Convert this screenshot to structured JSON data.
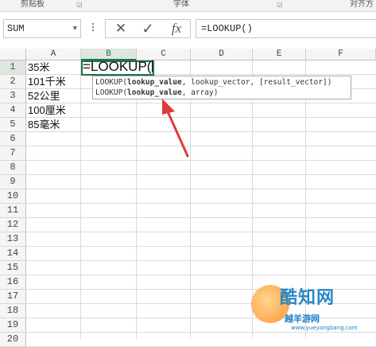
{
  "ribbon": {
    "group1": "剪贴板",
    "group2": "字体",
    "group3": "对齐方"
  },
  "name_box": {
    "value": "SUM"
  },
  "formula_bar": {
    "cancel_glyph": "✕",
    "enter_glyph": "✓",
    "fx_label": "fx",
    "value": "=LOOKUP()"
  },
  "columns": [
    "A",
    "B",
    "C",
    "D",
    "E",
    "F"
  ],
  "rows": [
    "1",
    "2",
    "3",
    "4",
    "5",
    "6",
    "7",
    "8",
    "9",
    "10",
    "11",
    "12",
    "13",
    "14",
    "15",
    "16",
    "17",
    "18",
    "19",
    "20"
  ],
  "cells": {
    "A1": "35米",
    "A2": "101千米",
    "A3": "52公里",
    "A4": "100厘米",
    "A5": "85毫米"
  },
  "active_cell": {
    "ref": "B1",
    "text": "=LOOKUP("
  },
  "tooltip": {
    "line1_fn": "LOOKUP(",
    "line1_bold": "lookup_value",
    "line1_rest": ", lookup_vector, [result_vector])",
    "line2_fn": "LOOKUP(",
    "line2_bold": "lookup_value",
    "line2_rest": ", array)"
  },
  "watermark": {
    "title": "酷知网",
    "subtitle": "越羊游网",
    "url": "www.yueyangbang.com"
  },
  "colors": {
    "accent": "#217346",
    "arrow": "#e03a3a"
  }
}
